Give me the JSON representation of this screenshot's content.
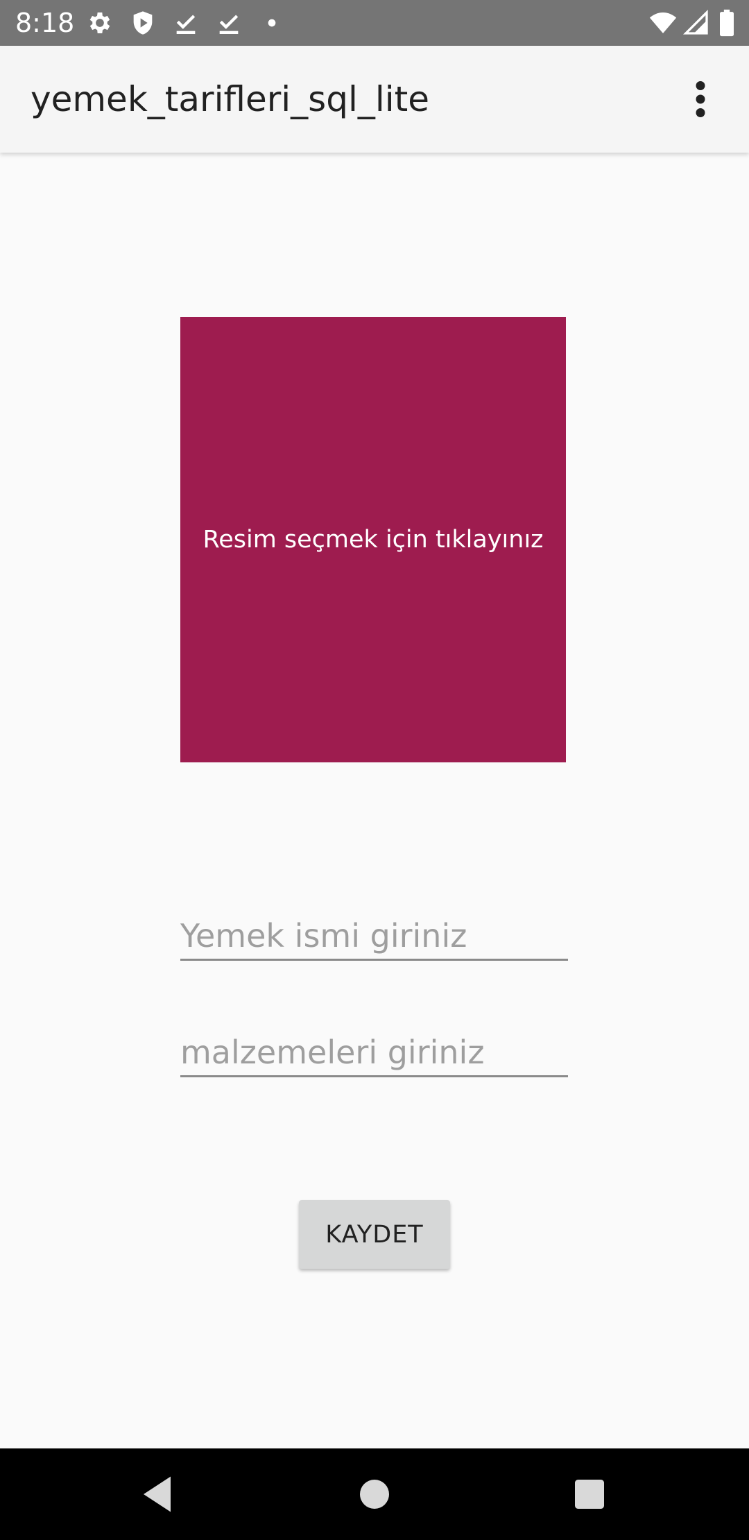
{
  "status_bar": {
    "time": "8:18",
    "icons": [
      "gear-icon",
      "shield-play-icon",
      "download-done-icon",
      "download-done-icon",
      "dot-icon",
      "wifi-icon",
      "signal-icon",
      "battery-icon"
    ]
  },
  "app_bar": {
    "title": "yemek_tarifleri_sql_lite",
    "overflow_icon": "more-vertical-icon"
  },
  "image_picker": {
    "label": "Resim seçmek için tıklayınız",
    "color": "#9e1c4f"
  },
  "form": {
    "name_placeholder": "Yemek ismi giriniz",
    "name_value": "",
    "ingredients_placeholder": "malzemeleri giriniz",
    "ingredients_value": ""
  },
  "save_button": {
    "label": "KAYDET"
  },
  "nav_bar": {
    "icons": [
      "back-icon",
      "home-icon",
      "recents-icon"
    ]
  }
}
